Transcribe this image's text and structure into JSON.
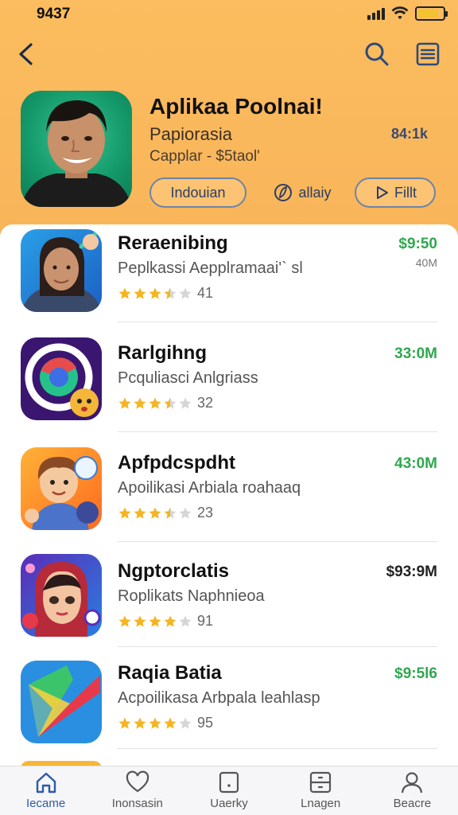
{
  "status": {
    "time": "9437"
  },
  "hero": {
    "title": "Aplikaa Poolnai!",
    "subtitle": "Papiorasia",
    "size": "84:1k",
    "meta": "Capplar - $5taol'",
    "chips": [
      {
        "label": "Indouian"
      },
      {
        "label": "allaiy"
      },
      {
        "label": "Fillt"
      }
    ]
  },
  "apps": [
    {
      "title": "Reraenibing",
      "desc": "Peplkassi Aepplramaai'` sl",
      "rating": 3.5,
      "count": "41",
      "price": "$9:50",
      "sub_price": "40M"
    },
    {
      "title": "Rarlgihng",
      "desc": "Pcquliasci Anlgriass",
      "rating": 3.5,
      "count": "32",
      "price": "33:0M",
      "sub_price": ""
    },
    {
      "title": "Apfpdcspdht",
      "desc": "Apoilikasi Arbiala roahaaq",
      "rating": 3.5,
      "count": "23",
      "price": "43:0M",
      "sub_price": ""
    },
    {
      "title": "Ngptorclatis",
      "desc": "Roplikats Naphnieoa",
      "rating": 4,
      "count": "91",
      "price": "$93:9M",
      "sub_price": ""
    },
    {
      "title": "Raqia Batia",
      "desc": "Acpoilikasa Arbpala leahlasp",
      "rating": 4,
      "count": "95",
      "price": "$9:5l6",
      "sub_price": ""
    }
  ],
  "tabs": [
    {
      "label": "Iecame"
    },
    {
      "label": "Inonsasin"
    },
    {
      "label": "Uaerky"
    },
    {
      "label": "Lnagen"
    },
    {
      "label": "Beacre"
    }
  ],
  "colors": {
    "header_bg": "#f9b45a",
    "price_green": "#2fa84f",
    "star": "#f4b520",
    "chip_border": "#6c84a8",
    "tab_active": "#2c5ba8"
  }
}
